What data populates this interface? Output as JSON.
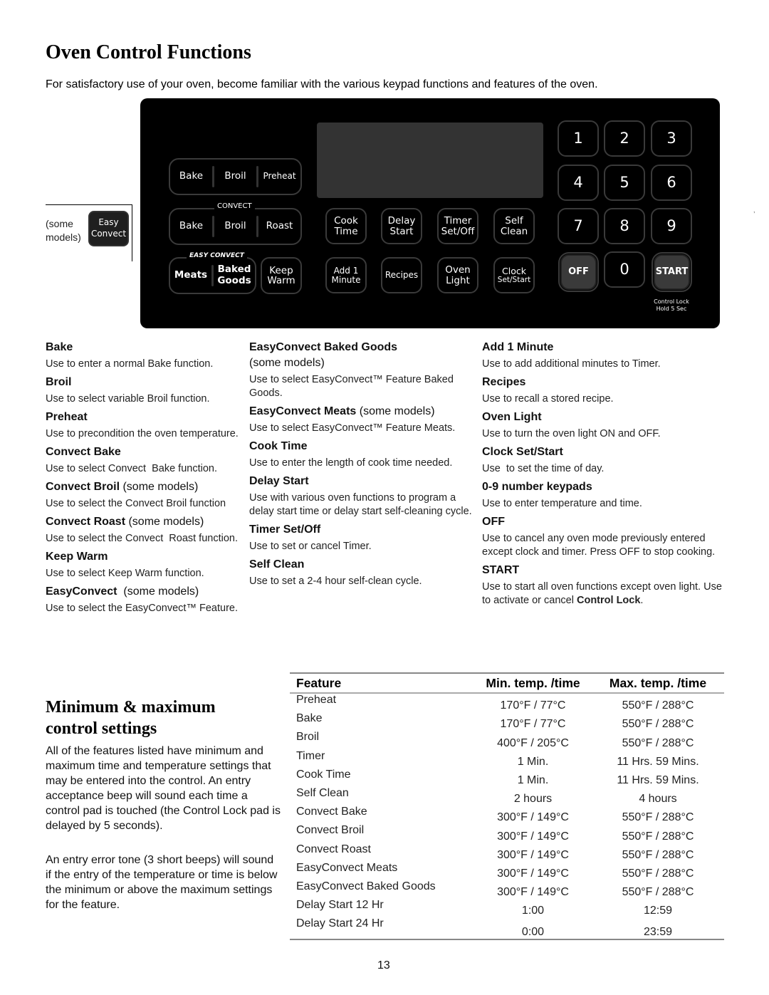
{
  "page": {
    "title": "Oven Control Functions",
    "intro": "For satisfactory use of your oven, become familiar with the various keypad functions and features of the oven.",
    "page_number": "13"
  },
  "panel": {
    "row1": [
      "Bake",
      "Broil",
      "Preheat"
    ],
    "convect_label": "CONVECT",
    "row2": [
      "Bake",
      "Broil",
      "Roast"
    ],
    "easy_convect_label": "EASY CONVECT",
    "easy_meats": "Meats",
    "easy_baked_goods": [
      "Baked",
      "Goods"
    ],
    "keep_warm": [
      "Keep",
      "Warm"
    ],
    "function_pads_row1": [
      [
        "Cook",
        "Time"
      ],
      [
        "Delay",
        "Start"
      ],
      [
        "Timer",
        "Set/Off"
      ],
      [
        "Self",
        "Clean"
      ]
    ],
    "function_pads_row2": [
      [
        "Add 1",
        "Minute"
      ],
      [
        "Recipes",
        ""
      ],
      [
        "Oven",
        "Light"
      ],
      [
        "Clock",
        "Set/Start"
      ]
    ],
    "numbers": [
      "1",
      "2",
      "3",
      "4",
      "5",
      "6",
      "7",
      "8",
      "9",
      "0"
    ],
    "off_label": "OFF",
    "start_label": "START",
    "control_lock_note": [
      "Control Lock",
      "Hold 5 Sec"
    ]
  },
  "callout": {
    "note": [
      "(some",
      "models)"
    ],
    "button": [
      "Easy",
      "Convect"
    ]
  },
  "descriptions": {
    "col1": [
      {
        "title": "Bake",
        "suffix": "",
        "text": "Use to enter a normal Bake function."
      },
      {
        "title": "Broil",
        "suffix": "",
        "text": "Use to select variable Broil function."
      },
      {
        "title": "Preheat",
        "suffix": "",
        "text": "Use to precondition the oven temperature."
      },
      {
        "title": "Convect Bake",
        "suffix": "",
        "text": "Use to select Convect  Bake function."
      },
      {
        "title": "Convect Broil",
        "suffix": " (some models)",
        "text": "Use to select the Convect Broil function"
      },
      {
        "title": "Convect Roast",
        "suffix": " (some models)",
        "text": "Use to select the Convect  Roast function."
      },
      {
        "title": "Keep Warm",
        "suffix": "",
        "text": "Use to select Keep Warm function."
      },
      {
        "title": "EasyConvect",
        "suffix": "  (some models)",
        "text": "Use to select the EasyConvect™ Feature."
      }
    ],
    "col2": [
      {
        "title": "EasyConvect Baked Goods",
        "suffix": "(some models)",
        "text": "Use to select EasyConvect™ Feature Baked Goods."
      },
      {
        "title": "EasyConvect Meats",
        "suffix": " (some models)",
        "text": "Use to select EasyConvect™ Feature Meats."
      },
      {
        "title": "Cook Time",
        "suffix": "",
        "text": "Use to enter the length of cook time needed."
      },
      {
        "title": "Delay Start",
        "suffix": "",
        "text": "Use with various oven functions to program a delay start time or delay start self-cleaning cycle."
      },
      {
        "title": "Timer Set/Off",
        "suffix": "",
        "text": "Use to set or cancel Timer."
      },
      {
        "title": "Self Clean",
        "suffix": "",
        "text": "Use to set a 2-4 hour self-clean cycle."
      }
    ],
    "col3": [
      {
        "title": "Add 1 Minute",
        "suffix": "",
        "text": "Use to add additional minutes to Timer."
      },
      {
        "title": "Recipes",
        "suffix": "",
        "text": "Use to recall a stored recipe."
      },
      {
        "title": "Oven Light",
        "suffix": "",
        "text": "Use to turn the oven light ON and OFF."
      },
      {
        "title": "Clock Set/Start",
        "suffix": "",
        "text": "Use  to set the time of day."
      },
      {
        "title": "0-9 number keypads",
        "suffix": "",
        "text": "Use to enter temperature and time."
      },
      {
        "title": "OFF",
        "suffix": "",
        "text": "Use to cancel any oven mode previously entered except clock and timer. Press OFF to stop cooking."
      },
      {
        "title": "START",
        "suffix": "",
        "text": "Use to start all oven functions except oven light. Use to activate or cancel ",
        "text_bold": "Control Lock",
        "text_end": "."
      }
    ]
  },
  "min_max": {
    "heading": "Minimum & maximum control settings",
    "para1": "All of the features listed have minimum and maximum time and temperature settings that may be entered into the control.  An entry acceptance beep will sound each time a control pad is touched (the Control Lock pad is delayed by 5 seconds).",
    "para2": "An entry error tone (3 short beeps) will sound if the entry of the temperature or time is below the minimum or above the maximum settings for the feature.",
    "table": {
      "headers": [
        "Feature",
        "Min. temp. /time",
        "Max. temp. /time"
      ],
      "rows": [
        [
          "Preheat",
          "170°F / 77°C",
          "550°F / 288°C"
        ],
        [
          "Bake",
          "170°F / 77°C",
          "550°F / 288°C"
        ],
        [
          "Broil",
          "400°F / 205°C",
          "550°F / 288°C"
        ],
        [
          "Timer",
          "1 Min.",
          "11 Hrs. 59 Mins."
        ],
        [
          "Cook Time",
          "1 Min.",
          "11 Hrs. 59 Mins."
        ],
        [
          "Self Clean",
          "2 hours",
          "4 hours"
        ],
        [
          "Convect Bake",
          "300°F / 149°C",
          "550°F / 288°C"
        ],
        [
          "Convect Broil",
          "300°F / 149°C",
          "550°F / 288°C"
        ],
        [
          "Convect Roast",
          "300°F / 149°C",
          "550°F / 288°C"
        ],
        [
          "EasyConvect Meats",
          "300°F / 149°C",
          "550°F / 288°C"
        ],
        [
          "EasyConvect Baked Goods",
          "300°F / 149°C",
          "550°F / 288°C"
        ],
        [
          "Delay Start 12 Hr",
          "1:00",
          "12:59"
        ],
        [
          "Delay Start 24 Hr",
          "0:00",
          "23:59"
        ]
      ]
    }
  }
}
